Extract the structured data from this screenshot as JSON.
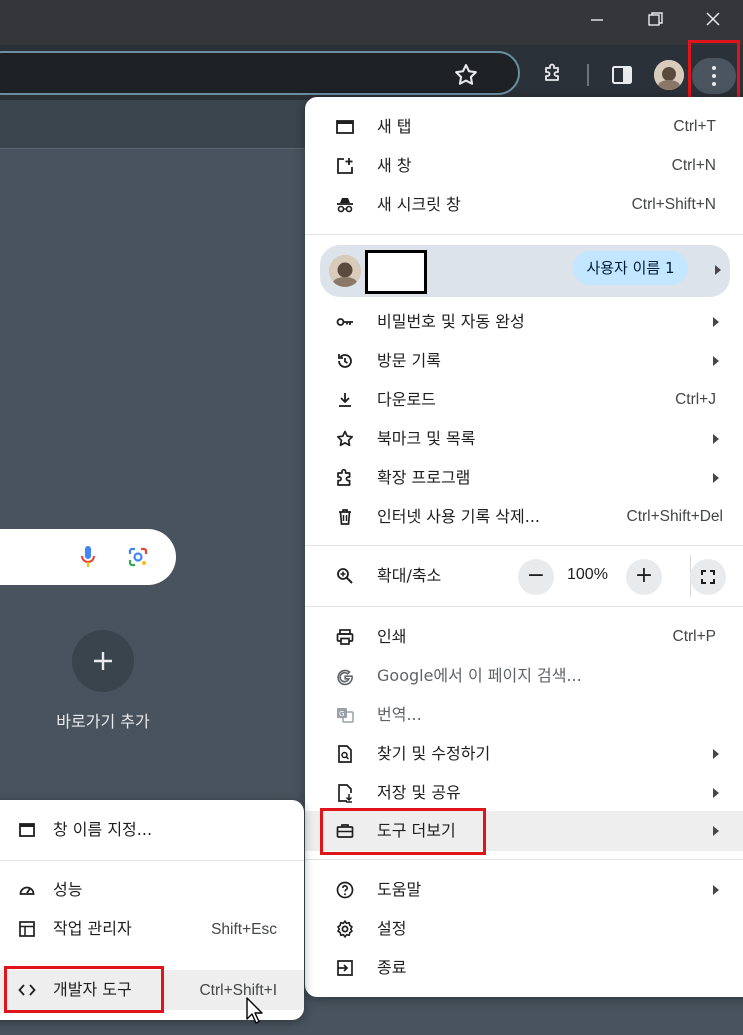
{
  "menu": {
    "items_top": [
      {
        "label": "새 탭",
        "shortcut": "Ctrl+T",
        "icon": "new-tab-icon"
      },
      {
        "label": "새 창",
        "shortcut": "Ctrl+N",
        "icon": "new-window-icon"
      },
      {
        "label": "새 시크릿 창",
        "shortcut": "Ctrl+Shift+N",
        "icon": "incognito-icon"
      }
    ],
    "profile": {
      "user_label": "사용자 이름 1"
    },
    "items_mid": [
      {
        "label": "비밀번호 및 자동 완성",
        "shortcut": "",
        "icon": "key-icon"
      },
      {
        "label": "방문 기록",
        "shortcut": "",
        "icon": "history-icon"
      },
      {
        "label": "다운로드",
        "shortcut": "Ctrl+J",
        "icon": "download-icon"
      },
      {
        "label": "북마크 및 목록",
        "shortcut": "",
        "icon": "bookmark-star-icon"
      },
      {
        "label": "확장 프로그램",
        "shortcut": "",
        "icon": "extension-icon"
      },
      {
        "label": "인터넷 사용 기록 삭제...",
        "shortcut": "Ctrl+Shift+Del",
        "icon": "trash-icon"
      }
    ],
    "zoom": {
      "label": "확대/축소",
      "minus": "−",
      "value": "100%",
      "plus": "+"
    },
    "items_tools": [
      {
        "label": "인쇄",
        "shortcut": "Ctrl+P",
        "icon": "print-icon"
      },
      {
        "label": "Google에서 이 페이지 검색...",
        "shortcut": "",
        "icon": "google-icon"
      },
      {
        "label": "번역...",
        "shortcut": "",
        "icon": "translate-icon"
      },
      {
        "label": "찾기 및 수정하기",
        "shortcut": "",
        "icon": "find-icon"
      },
      {
        "label": "저장 및 공유",
        "shortcut": "",
        "icon": "save-share-icon"
      },
      {
        "label": "도구 더보기",
        "shortcut": "",
        "icon": "toolbox-icon"
      }
    ],
    "items_bottom": [
      {
        "label": "도움말",
        "shortcut": "",
        "icon": "help-icon"
      },
      {
        "label": "설정",
        "shortcut": "",
        "icon": "settings-gear-icon"
      },
      {
        "label": "종료",
        "shortcut": "",
        "icon": "exit-icon"
      }
    ]
  },
  "submenu": {
    "items": [
      {
        "label": "창 이름 지정...",
        "shortcut": "",
        "icon": "window-name-icon"
      },
      {
        "label": "성능",
        "shortcut": "",
        "icon": "performance-icon"
      },
      {
        "label": "작업 관리자",
        "shortcut": "Shift+Esc",
        "icon": "task-manager-icon"
      },
      {
        "label": "개발자 도구",
        "shortcut": "Ctrl+Shift+I",
        "icon": "devtools-icon"
      }
    ]
  },
  "ntp": {
    "shortcut_add_label": "바로가기 추가"
  },
  "colors": {
    "highlight_box": "#e0151b",
    "menu_bg": "#ffffff",
    "page_bg": "#48535d"
  }
}
